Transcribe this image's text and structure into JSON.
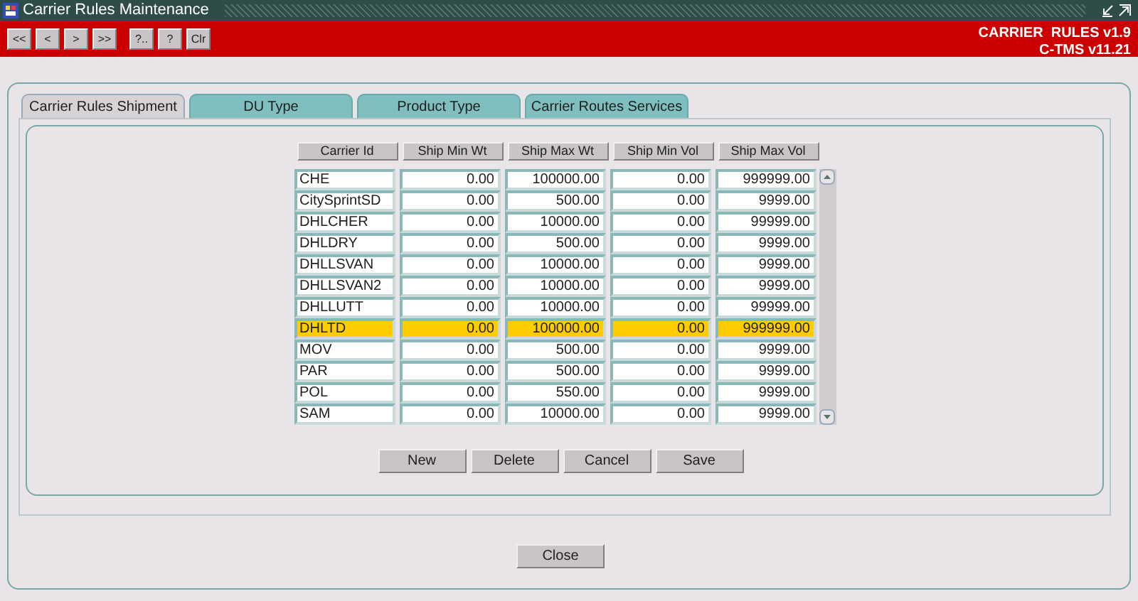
{
  "window": {
    "title": "Carrier Rules Maintenance"
  },
  "toolbar": {
    "buttons": [
      "<<",
      "<",
      ">",
      ">>",
      "?..",
      "?",
      "Clr"
    ],
    "version_lines": [
      "CARRIER  RULES v1.9",
      "C-TMS v11.21"
    ]
  },
  "tabs": [
    {
      "label": "Carrier Rules Shipment",
      "selected": true
    },
    {
      "label": "DU Type",
      "selected": false
    },
    {
      "label": "Product Type",
      "selected": false
    },
    {
      "label": "Carrier Routes Services",
      "selected": false
    }
  ],
  "table": {
    "columns": [
      "Carrier Id",
      "Ship Min Wt",
      "Ship Max Wt",
      "Ship Min Vol",
      "Ship Max Vol"
    ],
    "rows": [
      {
        "cells": [
          "CHE",
          "0.00",
          "100000.00",
          "0.00",
          "999999.00"
        ],
        "selected": false
      },
      {
        "cells": [
          "CitySprintSD",
          "0.00",
          "500.00",
          "0.00",
          "9999.00"
        ],
        "selected": false
      },
      {
        "cells": [
          "DHLCHER",
          "0.00",
          "10000.00",
          "0.00",
          "99999.00"
        ],
        "selected": false
      },
      {
        "cells": [
          "DHLDRY",
          "0.00",
          "500.00",
          "0.00",
          "9999.00"
        ],
        "selected": false
      },
      {
        "cells": [
          "DHLLSVAN",
          "0.00",
          "10000.00",
          "0.00",
          "9999.00"
        ],
        "selected": false
      },
      {
        "cells": [
          "DHLLSVAN2",
          "0.00",
          "10000.00",
          "0.00",
          "9999.00"
        ],
        "selected": false
      },
      {
        "cells": [
          "DHLLUTT",
          "0.00",
          "10000.00",
          "0.00",
          "99999.00"
        ],
        "selected": false
      },
      {
        "cells": [
          "DHLTD",
          "0.00",
          "100000.00",
          "0.00",
          "999999.00"
        ],
        "selected": true
      },
      {
        "cells": [
          "MOV",
          "0.00",
          "500.00",
          "0.00",
          "9999.00"
        ],
        "selected": false
      },
      {
        "cells": [
          "PAR",
          "0.00",
          "500.00",
          "0.00",
          "9999.00"
        ],
        "selected": false
      },
      {
        "cells": [
          "POL",
          "0.00",
          "550.00",
          "0.00",
          "9999.00"
        ],
        "selected": false
      },
      {
        "cells": [
          "SAM",
          "0.00",
          "10000.00",
          "0.00",
          "9999.00"
        ],
        "selected": false
      }
    ]
  },
  "actions": [
    "New",
    "Delete",
    "Cancel",
    "Save"
  ],
  "close_button": "Close"
}
